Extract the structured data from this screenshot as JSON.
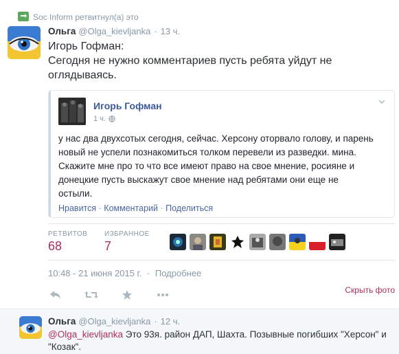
{
  "retweet": {
    "label": "Soc Inform ретвитнул(а) это",
    "icon": "retweet-icon"
  },
  "tweet": {
    "author_name": "Ольга",
    "author_handle": "@Olga_kievljanka",
    "separator": "·",
    "time": "13 ч.",
    "text_line1": "Игорь Гофман:",
    "text_line2": "Сегодня не нужно комментариев пусть ребята уйдут не оглядываясь."
  },
  "card": {
    "author": "Игорь Гофман",
    "time": "1 ч.",
    "body": "у нас два двухсотых сегодня, сейчас. Херсону оторвало голову, и парень новый не успели познакомиться толком перевели из разведки. мина. Скажите мне про то что все имеют право на свое мнение, росияне и донецкие пусть выскажут свое мнение над ребятами они еще не остыли.",
    "like": "Нравится",
    "comment": "Комментарий",
    "share": "Поделиться",
    "sep": " · "
  },
  "stats": {
    "retweets_label": "РЕТВИТОВ",
    "retweets_value": "68",
    "favorites_label": "ИЗБРАННОЕ",
    "favorites_value": "7"
  },
  "meta": {
    "timestamp": "10:48 - 21 июня 2015 г.",
    "separator": "·",
    "details": "Подробнее",
    "hide_photo": "Скрыть фото"
  },
  "reply": {
    "author_name": "Ольга",
    "author_handle": "@Olga_kievljanka",
    "separator": "·",
    "time": "12 ч.",
    "mention": "@Olga_kievljanka",
    "text": " Это 93я. район ДАП, Шахта. Позывные погибших \"Херсон\" и \"Козак\"."
  },
  "colors": {
    "accent": "#b02e55",
    "link": "#3b5998",
    "muted": "#8899a6"
  }
}
